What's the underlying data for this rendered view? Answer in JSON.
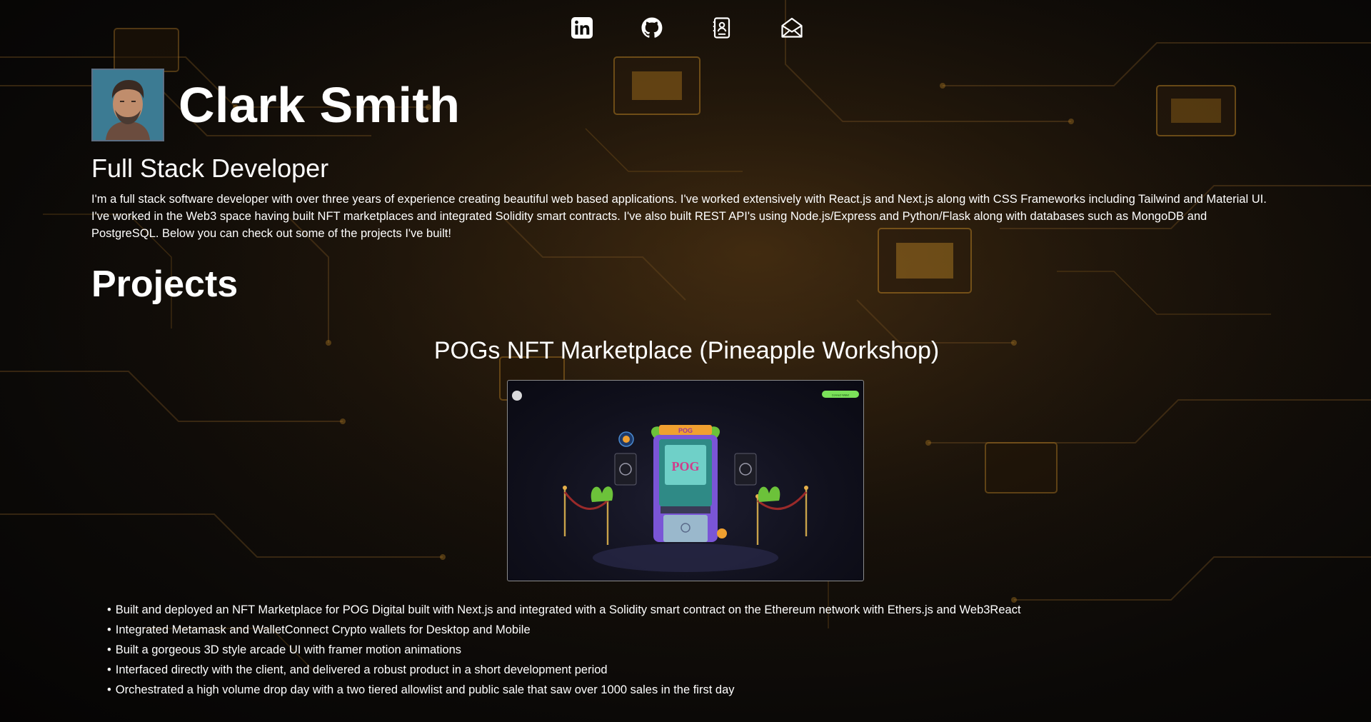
{
  "social": [
    {
      "name": "linkedin",
      "icon": "linkedin-icon"
    },
    {
      "name": "github",
      "icon": "github-icon"
    },
    {
      "name": "resume",
      "icon": "contact-card-icon"
    },
    {
      "name": "email",
      "icon": "envelope-icon"
    }
  ],
  "profile": {
    "name": "Clark Smith",
    "role": "Full Stack Developer",
    "bio": "I'm a full stack software developer with over three years of experience creating beautiful web based applications. I've worked extensively with React.js and Next.js along with CSS Frameworks including Tailwind and Material UI. I've worked in the Web3 space having built NFT marketplaces and integrated Solidity smart contracts. I've also built REST API's using Node.js/Express and Python/Flask along with databases such as MongoDB and PostgreSQL. Below you can check out some of the projects I've built!"
  },
  "projects_heading": "Projects",
  "project": {
    "title": "POGs NFT Marketplace (Pineapple Workshop)",
    "screenshot": {
      "connect_button": "Connect Wallet",
      "arcade_marquee": "POG",
      "arcade_screen": "POG"
    },
    "bullets": [
      "Built and deployed an NFT Marketplace for POG Digital built with Next.js and integrated with a Solidity smart contract on the Ethereum network with Ethers.js and Web3React",
      "Integrated Metamask and WalletConnect Crypto wallets for Desktop and Mobile",
      "Built a gorgeous 3D style arcade UI with framer motion animations",
      "Interfaced directly with the client, and delivered a robust product in a short development period",
      "Orchestrated a high volume drop day with a two tiered allowlist and public sale that saw over 1000 sales in the first day"
    ]
  },
  "colors": {
    "background": "#0b0907",
    "circuit_gold": "#c98a22",
    "text": "#ffffff",
    "button_green": "#7be15a"
  }
}
